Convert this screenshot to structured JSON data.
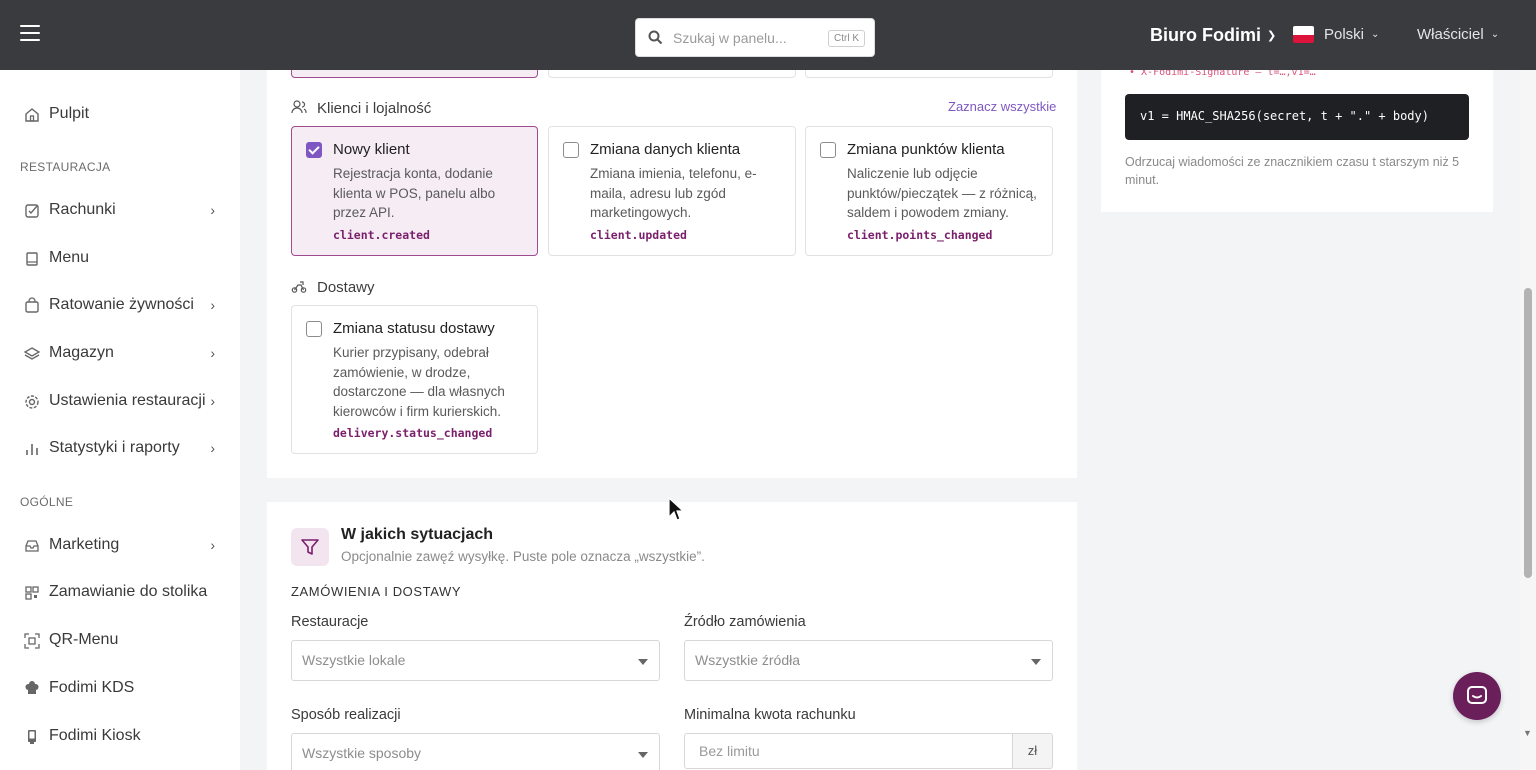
{
  "topbar": {
    "search_placeholder": "Szukaj w panelu...",
    "search_shortcut": "Ctrl K",
    "brand": "Biuro Fodimi",
    "language": "Polski",
    "role": "Właściciel"
  },
  "sidebar": {
    "sections": [
      {
        "label": "RESTAURACJA"
      },
      {
        "label": "OGÓLNE"
      }
    ],
    "items": [
      {
        "label": "Pulpit",
        "icon": "home-icon"
      },
      {
        "label": "Rachunki",
        "icon": "checklist-icon"
      },
      {
        "label": "Menu",
        "icon": "book-icon"
      },
      {
        "label": "Ratowanie żywności",
        "icon": "bag-icon"
      },
      {
        "label": "Magazyn",
        "icon": "layers-icon"
      },
      {
        "label": "Ustawienia restauracji",
        "icon": "gear-icon"
      },
      {
        "label": "Statystyki i raporty",
        "icon": "bar-chart-icon"
      },
      {
        "label": "Marketing",
        "icon": "inbox-icon"
      },
      {
        "label": "Zamawianie do stolika",
        "icon": "qr-icon"
      },
      {
        "label": "QR-Menu",
        "icon": "qr-scan-icon"
      },
      {
        "label": "Fodimi KDS",
        "icon": "chef-hat-icon"
      },
      {
        "label": "Fodimi Kiosk",
        "icon": "kiosk-icon"
      }
    ]
  },
  "events": {
    "select_all": "Zaznacz wszystkie",
    "categories": [
      {
        "label": "Klienci i lojalność",
        "items": [
          {
            "title": "Nowy klient",
            "desc": "Rejestracja konta, dodanie klienta w POS, panelu albo przez API.",
            "code": "client.created",
            "checked": true
          },
          {
            "title": "Zmiana danych klienta",
            "desc": "Zmiana imienia, telefonu, e-maila, adresu lub zgód marketingowych.",
            "code": "client.updated",
            "checked": false
          },
          {
            "title": "Zmiana punktów klienta",
            "desc": "Naliczenie lub odjęcie punktów/pieczątek — z różnicą, saldem i powodem zmiany.",
            "code": "client.points_changed",
            "checked": false
          }
        ]
      },
      {
        "label": "Dostawy",
        "items": [
          {
            "title": "Zmiana statusu dostawy",
            "desc": "Kurier przypisany, odebrał zamówienie, w drodze, dostarczone — dla własnych kierowców i firm kurierskich.",
            "code": "delivery.status_changed",
            "checked": false
          }
        ]
      }
    ]
  },
  "signature": {
    "header_line": "• X-Fodimi-Signature — t=…,v1=…",
    "code": "v1 = HMAC_SHA256(secret, t + \".\" + body)",
    "note": "Odrzucaj wiadomości ze znacznikiem czasu t starszym niż 5 minut."
  },
  "filters": {
    "title": "W jakich sytuacjach",
    "subtitle": "Opcjonalnie zawęź wysyłkę. Puste pole oznacza „wszystkie”.",
    "section": "ZAMÓWIENIA I DOSTAWY",
    "restaurants_label": "Restauracje",
    "restaurants_value": "Wszystkie lokale",
    "source_label": "Źródło zamówienia",
    "source_value": "Wszystkie źródła",
    "method_label": "Sposób realizacji",
    "method_value": "Wszystkie sposoby",
    "min_amount_label": "Minimalna kwota rachunku",
    "min_amount_placeholder": "Bez limitu",
    "currency": "zł"
  },
  "colors": {
    "topbar": "#393b3f",
    "accent": "#7e57c2",
    "brand_plum": "#6a1e5a",
    "selected_bg": "#f6ecf4"
  }
}
